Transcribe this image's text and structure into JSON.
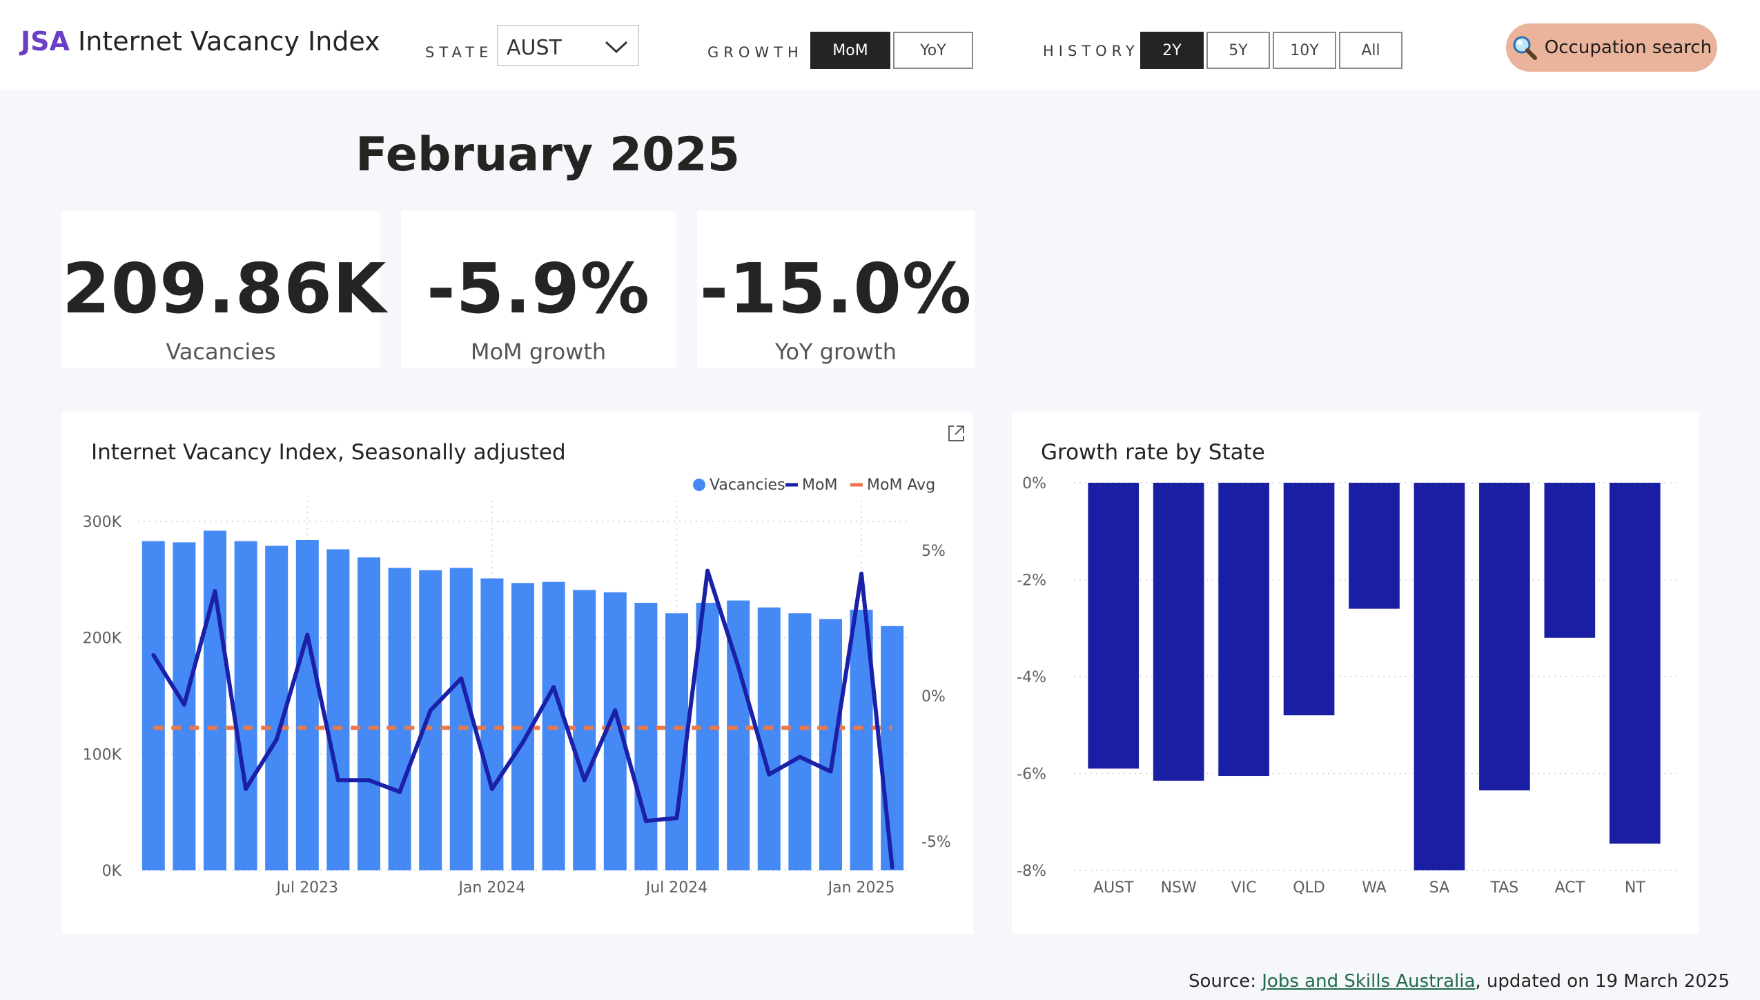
{
  "brand": {
    "abbr": "JSA",
    "title": "Internet Vacancy Index"
  },
  "filters": {
    "state_label": "STATE",
    "state_value": "AUST",
    "growth_label": "GROWTH",
    "growth_options": [
      "MoM",
      "YoY"
    ],
    "growth_selected": "MoM",
    "history_label": "HISTORY",
    "history_options": [
      "2Y",
      "5Y",
      "10Y",
      "All"
    ],
    "history_selected": "2Y"
  },
  "occupation_button": {
    "label": "Occupation search",
    "icon": "magnifier-icon"
  },
  "headline": "February 2025",
  "kpis": [
    {
      "value": "209.86K",
      "label": "Vacancies"
    },
    {
      "value": "-5.9%",
      "label": "MoM growth"
    },
    {
      "value": "-15.0%",
      "label": "YoY growth"
    }
  ],
  "colors": {
    "vacancies": "#4589f5",
    "mom": "#1a21a8",
    "mom_avg": "#e8794b",
    "state_bars": "#1a1ea3",
    "accent_button": "#eab49c"
  },
  "chart_data": [
    {
      "type": "bar",
      "title": "Internet Vacancy Index, Seasonally adjusted",
      "legend": [
        "Vacancies",
        "MoM",
        "MoM Avg"
      ],
      "legend_position": "top-right",
      "x_tick_labels": [
        "Jul 2023",
        "Jan 2024",
        "Jul 2024",
        "Jan 2025"
      ],
      "x_tick_indices": [
        5,
        11,
        17,
        23
      ],
      "y_left_ticks": [
        "0K",
        "100K",
        "200K",
        "300K"
      ],
      "y_left_lim": [
        0,
        300
      ],
      "y_right_ticks": [
        "-5%",
        "0%",
        "5%"
      ],
      "y_right_lim": [
        -6,
        6
      ],
      "grid": true,
      "series": [
        {
          "name": "Vacancies",
          "kind": "bar",
          "unit": "K",
          "values": [
            283,
            282,
            292,
            283,
            279,
            284,
            276,
            269,
            260,
            258,
            260,
            251,
            247,
            248,
            241,
            239,
            230,
            221,
            230,
            232,
            226,
            221,
            216,
            224,
            210
          ]
        },
        {
          "name": "MoM",
          "kind": "line",
          "unit": "%",
          "values": [
            1.4,
            -0.3,
            3.6,
            -3.2,
            -1.5,
            2.1,
            -2.9,
            -2.9,
            -3.3,
            -0.5,
            0.6,
            -3.2,
            -1.6,
            0.3,
            -2.9,
            -0.5,
            -4.3,
            -4.2,
            4.3,
            1.0,
            -2.7,
            -2.1,
            -2.6,
            4.2,
            -5.9
          ]
        },
        {
          "name": "MoM Avg",
          "kind": "line",
          "unit": "%",
          "values": [
            -1.1
          ]
        }
      ]
    },
    {
      "type": "bar",
      "title": "Growth rate by State",
      "categories": [
        "AUST",
        "NSW",
        "VIC",
        "QLD",
        "WA",
        "SA",
        "TAS",
        "ACT",
        "NT"
      ],
      "values": [
        -5.9,
        -6.15,
        -6.05,
        -4.8,
        -2.6,
        -8.0,
        -6.35,
        -3.2,
        -7.45
      ],
      "unit": "%",
      "y_ticks": [
        "0%",
        "-2%",
        "-4%",
        "-6%",
        "-8%"
      ],
      "ylim": [
        -8,
        0
      ],
      "grid": true
    }
  ],
  "source": {
    "prefix": "Source: ",
    "link": "Jobs and Skills Australia",
    "suffix": ", updated on 19 March 2025"
  }
}
